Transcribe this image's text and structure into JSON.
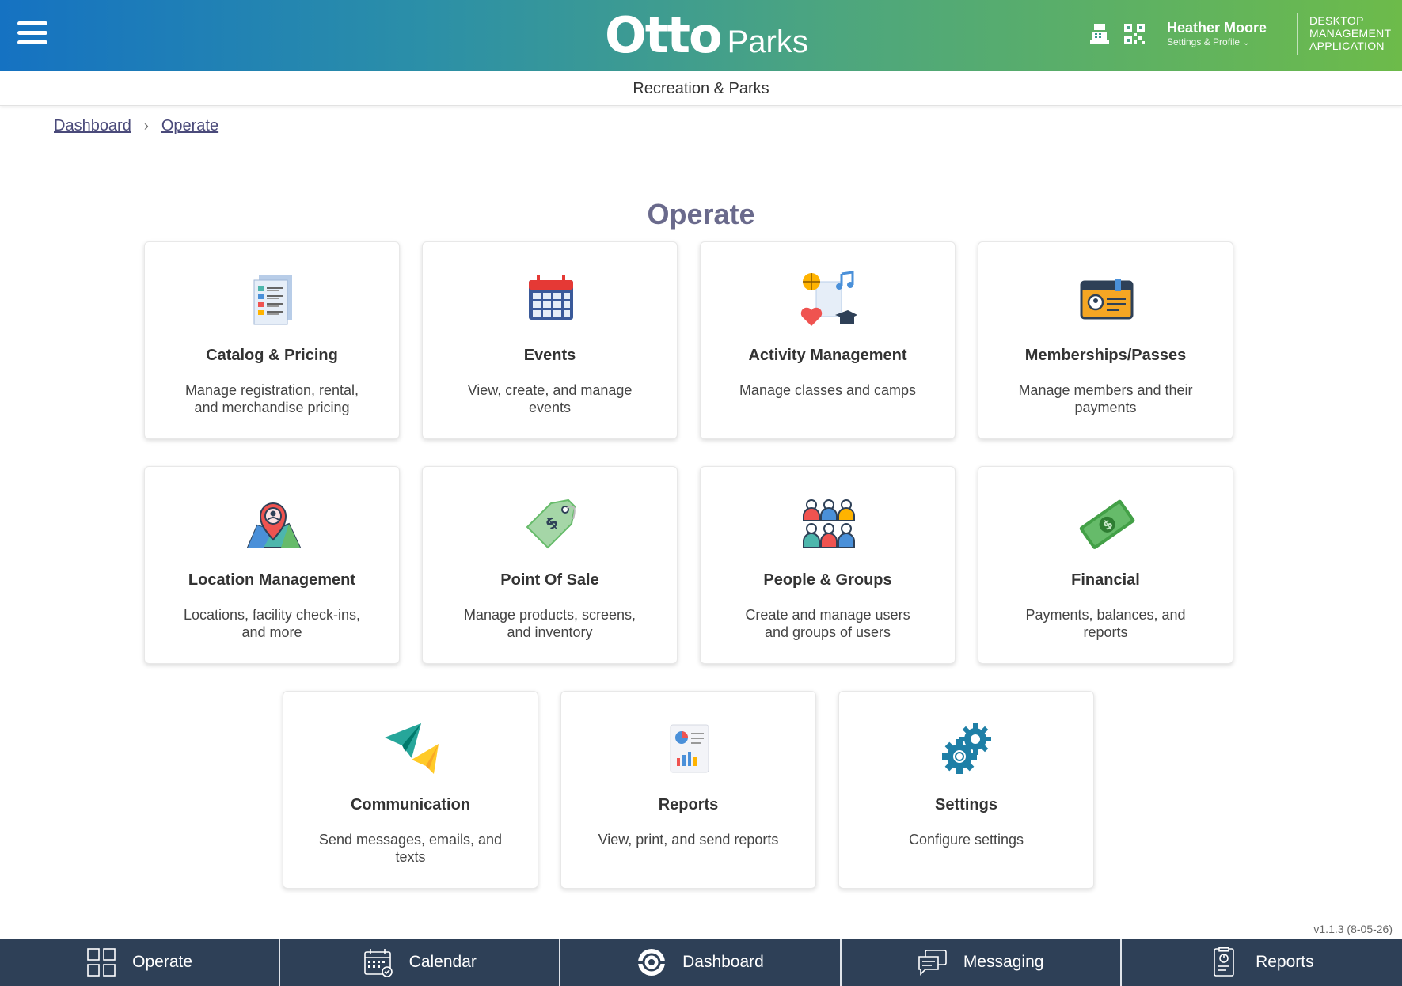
{
  "header": {
    "logo_main": "Otto",
    "logo_sub": "Parks",
    "user_name": "Heather Moore",
    "user_sub": "Settings & Profile",
    "app_line1": "DESKTOP",
    "app_line2": "MANAGEMENT",
    "app_line3": "APPLICATION",
    "icons": [
      "menu-icon",
      "register-icon",
      "qr-code-icon",
      "chevron-down-icon"
    ]
  },
  "subheader": {
    "title": "Recreation & Parks"
  },
  "breadcrumb": {
    "items": [
      "Dashboard",
      "Operate"
    ]
  },
  "page": {
    "title": "Operate"
  },
  "cards": [
    {
      "title": "Catalog & Pricing",
      "desc": "Manage registration, rental, and merchandise pricing",
      "icon": "catalog-icon"
    },
    {
      "title": "Events",
      "desc": "View, create, and manage events",
      "icon": "calendar-icon"
    },
    {
      "title": "Activity Management",
      "desc": "Manage classes and camps",
      "icon": "activity-icon"
    },
    {
      "title": "Memberships/Passes",
      "desc": "Manage members and their payments",
      "icon": "membership-card-icon"
    },
    {
      "title": "Location Management",
      "desc": "Locations, facility check-ins, and more",
      "icon": "location-pin-icon"
    },
    {
      "title": "Point Of Sale",
      "desc": "Manage products, screens, and inventory",
      "icon": "price-tag-icon"
    },
    {
      "title": "People & Groups",
      "desc": "Create and manage users and groups of users",
      "icon": "people-icon"
    },
    {
      "title": "Financial",
      "desc": "Payments, balances, and reports",
      "icon": "money-icon"
    },
    {
      "title": "Communication",
      "desc": "Send messages, emails, and texts",
      "icon": "paper-plane-icon"
    },
    {
      "title": "Reports",
      "desc": "View, print, and send reports",
      "icon": "report-icon"
    },
    {
      "title": "Settings",
      "desc": "Configure settings",
      "icon": "gear-icon"
    }
  ],
  "version": "v1.1.3 (8-05-26)",
  "bottom_nav": [
    {
      "label": "Operate",
      "icon": "grid-icon"
    },
    {
      "label": "Calendar",
      "icon": "calendar-icon"
    },
    {
      "label": "Dashboard",
      "icon": "dashboard-icon"
    },
    {
      "label": "Messaging",
      "icon": "messaging-icon"
    },
    {
      "label": "Reports",
      "icon": "report-icon"
    }
  ]
}
